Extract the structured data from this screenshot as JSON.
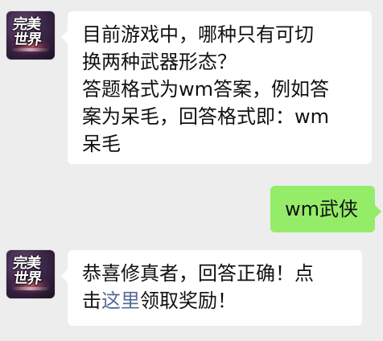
{
  "messages": {
    "question": {
      "sender": "bot",
      "avatar_text": [
        "完美",
        "世界"
      ],
      "line1": "目前游戏中，哪种只有可切",
      "line2": "换两种武器形态？",
      "line3": "答题格式为wm答案，例如答",
      "line4": "案为呆毛，回答格式即：wm",
      "line5": "呆毛"
    },
    "reply": {
      "sender": "user",
      "text": "wm武侠"
    },
    "result": {
      "sender": "bot",
      "avatar_text": [
        "完美",
        "世界"
      ],
      "line1": "恭喜修真者，回答正确！点",
      "line2_prefix": "击",
      "link_text": "这里",
      "line2_suffix": "领取奖励！"
    }
  },
  "colors": {
    "background": "#ededed",
    "incoming_bubble": "#ffffff",
    "outgoing_bubble": "#95ec69",
    "link": "#576b95",
    "text": "#111111"
  }
}
